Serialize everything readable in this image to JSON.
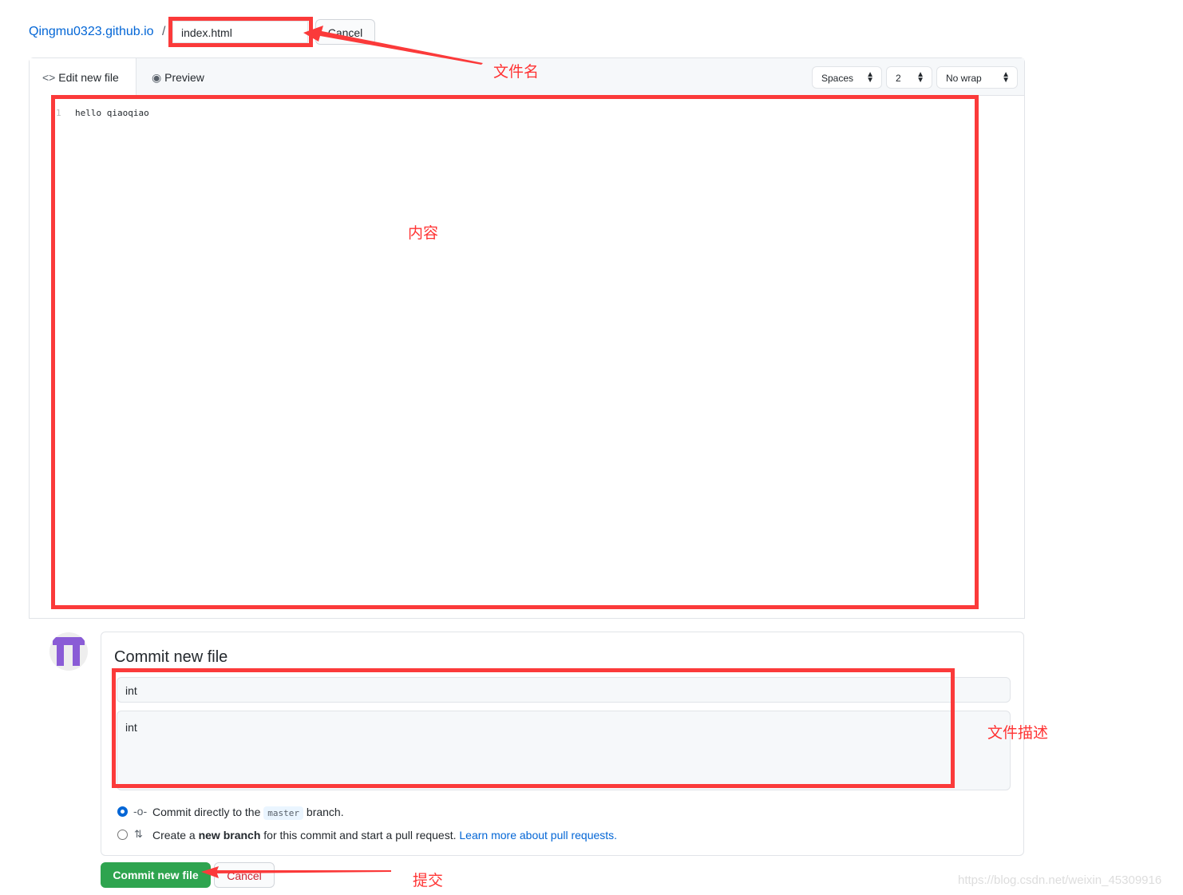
{
  "breadcrumb": {
    "repo": "Qingmu0323.github.io",
    "separator": "/"
  },
  "filename": {
    "value": "index.html"
  },
  "header_cancel": "Cancel",
  "editor": {
    "tabs": [
      {
        "label": "Edit new file",
        "icon": "code-icon",
        "active": true
      },
      {
        "label": "Preview",
        "icon": "eye-icon",
        "active": false
      }
    ],
    "indent_mode": "Spaces",
    "indent_size": "2",
    "wrap_mode": "No wrap",
    "lines": [
      {
        "number": "1",
        "text": "hello qiaoqiao"
      }
    ]
  },
  "commit": {
    "title": "Commit new file",
    "summary": "int",
    "description": "int",
    "option_direct": {
      "prefix": "Commit directly to the",
      "branch": "master",
      "suffix": "branch.",
      "selected": true
    },
    "option_new": {
      "prefix": "Create a",
      "bold": "new branch",
      "suffix": "for this commit and start a pull request.",
      "link": "Learn more about pull requests.",
      "selected": false
    },
    "submit": "Commit new file",
    "cancel": "Cancel"
  },
  "annotations": {
    "filename": "文件名",
    "content": "内容",
    "description": "文件描述",
    "submit": "提交"
  },
  "watermark": "https://blog.csdn.net/weixin_45309916",
  "colors": {
    "annotation": "#fb3a3a",
    "primary": "#2ea44f",
    "link": "#0366d6",
    "avatar": "#8a5cd6"
  }
}
